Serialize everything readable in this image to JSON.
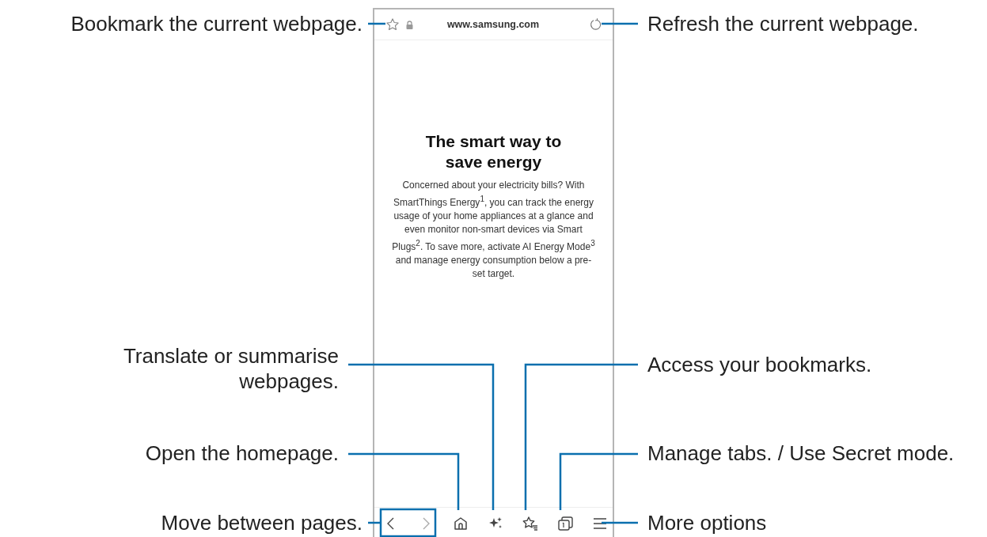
{
  "browser": {
    "url": "www.samsung.com",
    "headline": "The smart way to save energy",
    "body": "Concerned about your electricity bills? With SmartThings Energy$^{1}$, you can track the energy usage of your home appliances at a glance and even monitor non-smart devices via Smart Plugs$^{2}$. To save more, activate AI Energy Mode$^{3}$ and manage energy consumption below a pre-set target."
  },
  "callouts": [
    {
      "text": "Bookmark the current webpage."
    },
    {
      "text": "Refresh the current webpage."
    },
    {
      "text": "Translate or summarise webpages."
    },
    {
      "text": "Access your bookmarks."
    },
    {
      "text": "Open the homepage."
    },
    {
      "text": "Manage tabs. / Use Secret mode."
    },
    {
      "text": "Move between pages."
    },
    {
      "text": "More options"
    }
  ]
}
